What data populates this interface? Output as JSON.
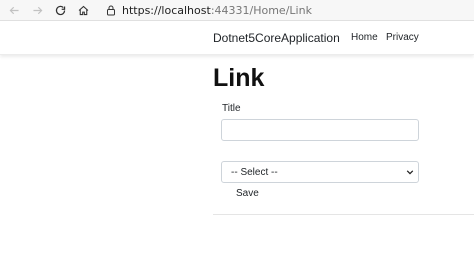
{
  "browser": {
    "url_host": "https://localhost",
    "url_rest": ":44331/Home/Link",
    "icons": [
      "back-icon",
      "forward-icon",
      "refresh-icon",
      "home-icon",
      "lock-icon"
    ]
  },
  "navbar": {
    "brand": "Dotnet5CoreApplication",
    "links": [
      "Home",
      "Privacy"
    ]
  },
  "main": {
    "heading": "Link",
    "title_label": "Title",
    "title_value": "",
    "select_value": "-- Select --",
    "save_label": "Save"
  },
  "colors": {
    "input_border": "#ced4da",
    "text": "#212529"
  }
}
